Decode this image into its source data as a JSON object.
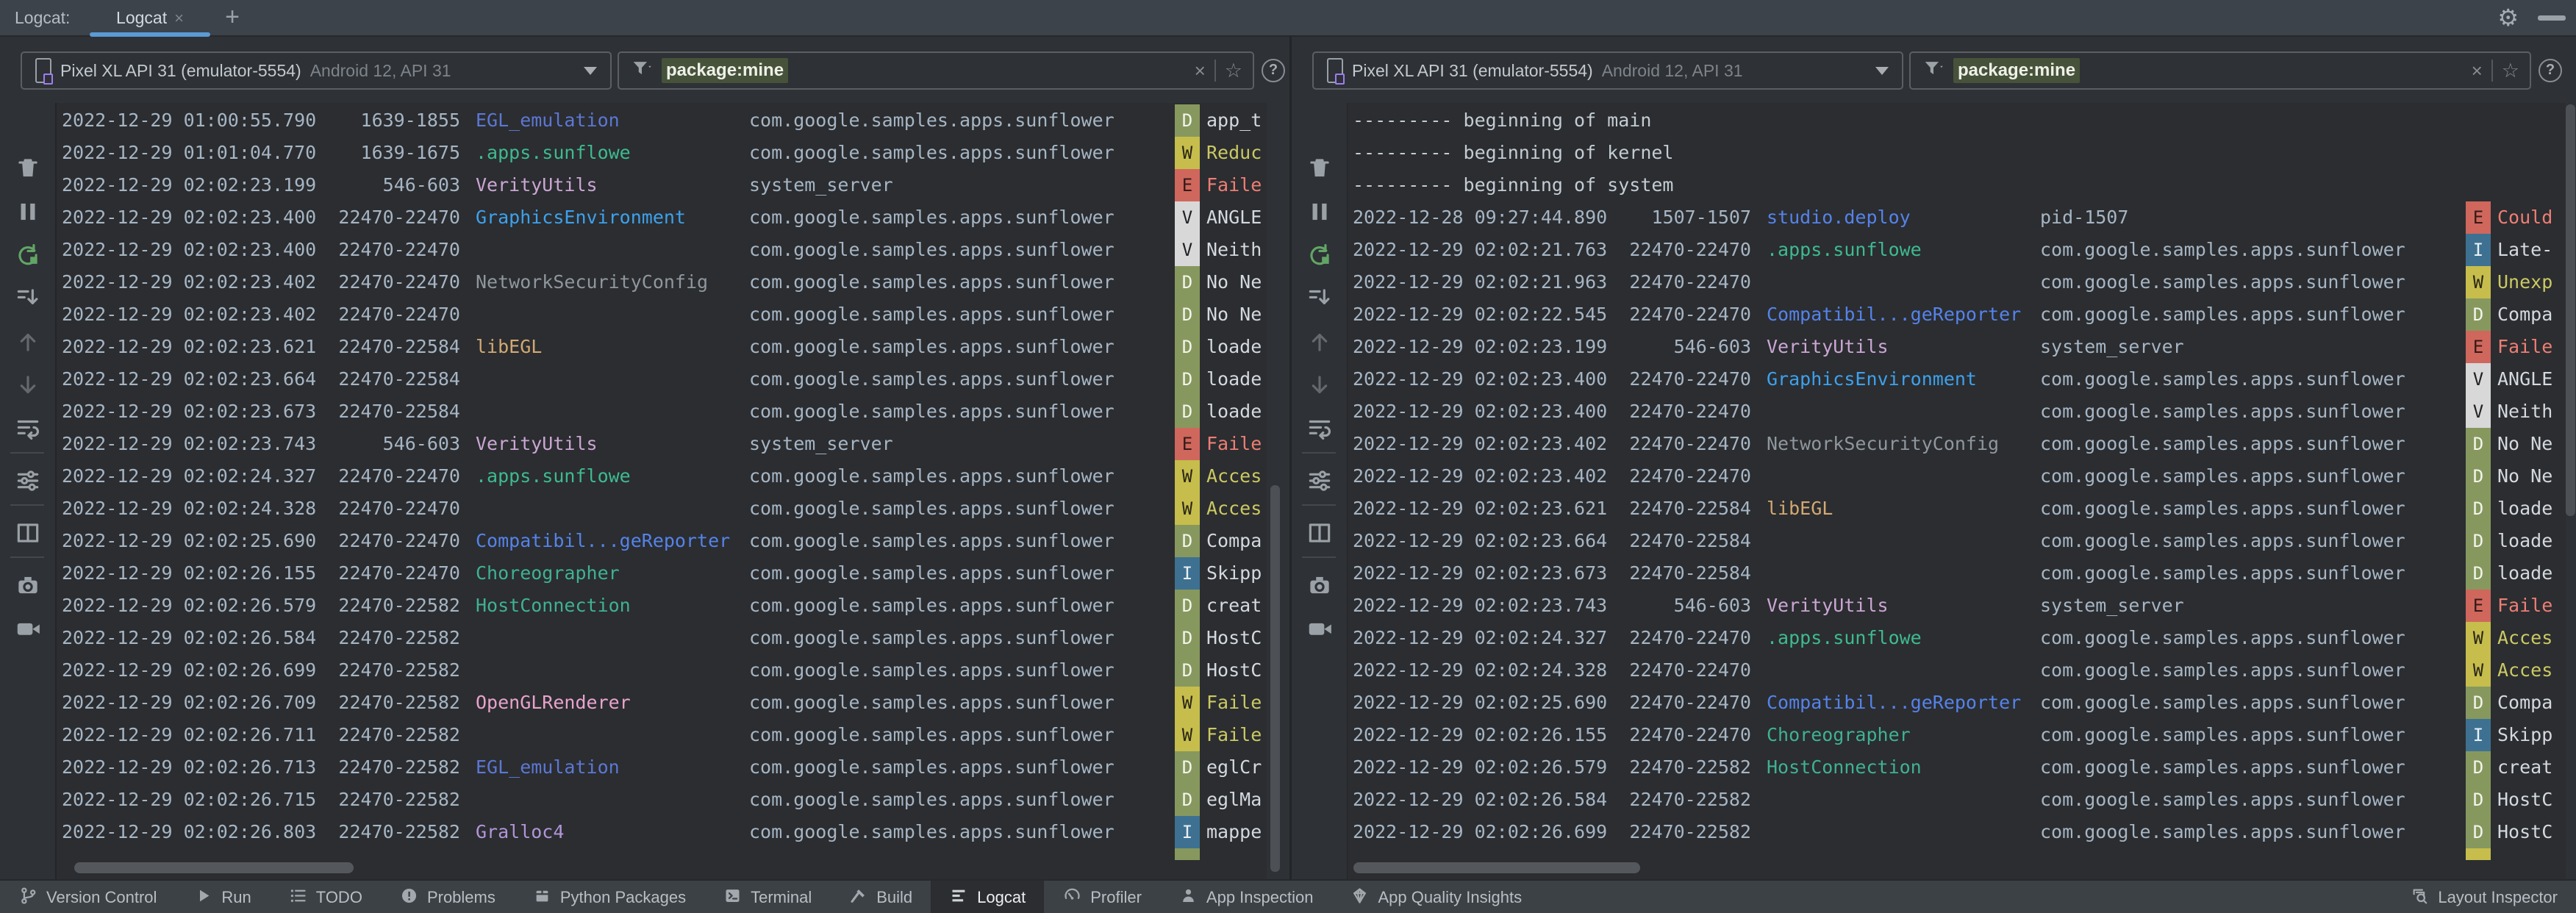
{
  "tabbar": {
    "window_label": "Logcat:",
    "tab_label": "Logcat",
    "close_label": "×",
    "add_label": "+"
  },
  "packages": {
    "app": "com.google.samples.apps.sunflower",
    "sys": "system_server",
    "pid1507": "pid-1507"
  },
  "tag_colors": {
    "blue": "#5c77d4",
    "teal": "#3eba90",
    "pink": "#cba6d4",
    "brightblue": "#3da1ed",
    "gray": "#8f979e",
    "tan": "#d3a972",
    "blue2": "#5583ea",
    "teal2": "#3fb194",
    "pink2": "#e8a3cd",
    "lavender": "#b295d8"
  },
  "level_colors": {
    "D": "#87985e",
    "W": "#c6bd4c",
    "E": "#cf675d",
    "V": "#d8d8d8",
    "I": "#3e7191"
  },
  "toolbar": {
    "icons": [
      "clear-logcat",
      "pause",
      "restart-logcat",
      "scroll-to-end",
      "previous-occurrence",
      "next-occurrence",
      "soft-wrap",
      "configure-logcat",
      "split-panels",
      "screenshot",
      "screen-record"
    ],
    "separators_after": [
      6,
      7,
      8
    ]
  },
  "panels": [
    {
      "device": {
        "name": "Pixel XL API 31 (emulator-5554)",
        "info": "Android 12, API 31"
      },
      "filter": {
        "value": "package:mine"
      },
      "partial_badge": "D",
      "rows": [
        {
          "t": "2022-12-29 01:00:55.790",
          "p": "1639-1855",
          "g": "EGL_emulation",
          "c": "blue",
          "k": "app",
          "l": "D",
          "m": "app_t"
        },
        {
          "t": "2022-12-29 01:01:04.770",
          "p": "1639-1675",
          "g": ".apps.sunflowe",
          "c": "teal",
          "k": "app",
          "l": "W",
          "m": "Reduc"
        },
        {
          "t": "2022-12-29 02:02:23.199",
          "p": "546-603 ",
          "g": "VerityUtils",
          "c": "pink",
          "k": "sys",
          "l": "E",
          "m": "Faile"
        },
        {
          "t": "2022-12-29 02:02:23.400",
          "p": "22470-22470",
          "g": "GraphicsEnvironment",
          "c": "brightblue",
          "k": "app",
          "l": "V",
          "m": "ANGLE"
        },
        {
          "t": "2022-12-29 02:02:23.400",
          "p": "22470-22470",
          "g": "",
          "c": "",
          "k": "app",
          "l": "V",
          "m": "Neith"
        },
        {
          "t": "2022-12-29 02:02:23.402",
          "p": "22470-22470",
          "g": "NetworkSecurityConfig",
          "c": "gray",
          "k": "app",
          "l": "D",
          "m": "No Ne"
        },
        {
          "t": "2022-12-29 02:02:23.402",
          "p": "22470-22470",
          "g": "",
          "c": "",
          "k": "app",
          "l": "D",
          "m": "No Ne"
        },
        {
          "t": "2022-12-29 02:02:23.621",
          "p": "22470-22584",
          "g": "libEGL",
          "c": "tan",
          "k": "app",
          "l": "D",
          "m": "loade"
        },
        {
          "t": "2022-12-29 02:02:23.664",
          "p": "22470-22584",
          "g": "",
          "c": "",
          "k": "app",
          "l": "D",
          "m": "loade"
        },
        {
          "t": "2022-12-29 02:02:23.673",
          "p": "22470-22584",
          "g": "",
          "c": "",
          "k": "app",
          "l": "D",
          "m": "loade"
        },
        {
          "t": "2022-12-29 02:02:23.743",
          "p": "546-603 ",
          "g": "VerityUtils",
          "c": "pink",
          "k": "sys",
          "l": "E",
          "m": "Faile"
        },
        {
          "t": "2022-12-29 02:02:24.327",
          "p": "22470-22470",
          "g": ".apps.sunflowe",
          "c": "teal",
          "k": "app",
          "l": "W",
          "m": "Acces"
        },
        {
          "t": "2022-12-29 02:02:24.328",
          "p": "22470-22470",
          "g": "",
          "c": "",
          "k": "app",
          "l": "W",
          "m": "Acces"
        },
        {
          "t": "2022-12-29 02:02:25.690",
          "p": "22470-22470",
          "g": "Compatibil...geReporter",
          "c": "blue2",
          "k": "app",
          "l": "D",
          "m": "Compa"
        },
        {
          "t": "2022-12-29 02:02:26.155",
          "p": "22470-22470",
          "g": "Choreographer",
          "c": "teal2",
          "k": "app",
          "l": "I",
          "m": "Skipp"
        },
        {
          "t": "2022-12-29 02:02:26.579",
          "p": "22470-22582",
          "g": "HostConnection",
          "c": "teal2",
          "k": "app",
          "l": "D",
          "m": "creat"
        },
        {
          "t": "2022-12-29 02:02:26.584",
          "p": "22470-22582",
          "g": "",
          "c": "",
          "k": "app",
          "l": "D",
          "m": "HostC"
        },
        {
          "t": "2022-12-29 02:02:26.699",
          "p": "22470-22582",
          "g": "",
          "c": "",
          "k": "app",
          "l": "D",
          "m": "HostC"
        },
        {
          "t": "2022-12-29 02:02:26.709",
          "p": "22470-22582",
          "g": "OpenGLRenderer",
          "c": "pink2",
          "k": "app",
          "l": "W",
          "m": "Faile"
        },
        {
          "t": "2022-12-29 02:02:26.711",
          "p": "22470-22582",
          "g": "",
          "c": "",
          "k": "app",
          "l": "W",
          "m": "Faile"
        },
        {
          "t": "2022-12-29 02:02:26.713",
          "p": "22470-22582",
          "g": "EGL_emulation",
          "c": "blue",
          "k": "app",
          "l": "D",
          "m": "eglCr"
        },
        {
          "t": "2022-12-29 02:02:26.715",
          "p": "22470-22582",
          "g": "",
          "c": "",
          "k": "app",
          "l": "D",
          "m": "eglMa"
        },
        {
          "t": "2022-12-29 02:02:26.803",
          "p": "22470-22582",
          "g": "Gralloc4",
          "c": "lavender",
          "k": "app",
          "l": "I",
          "m": "mappe"
        }
      ]
    },
    {
      "device": {
        "name": "Pixel XL API 31 (emulator-5554)",
        "info": "Android 12, API 31"
      },
      "filter": {
        "value": "package:mine"
      },
      "partial_badge": "W",
      "rows": [
        {
          "raw": "--------- beginning of main"
        },
        {
          "raw": "--------- beginning of kernel"
        },
        {
          "raw": "--------- beginning of system"
        },
        {
          "t": "2022-12-28 09:27:44.890",
          "p": "1507-1507",
          "g": "studio.deploy",
          "c": "blue2",
          "k": "pid1507",
          "l": "E",
          "m": "Could"
        },
        {
          "t": "2022-12-29 02:02:21.763",
          "p": "22470-22470",
          "g": ".apps.sunflowe",
          "c": "teal",
          "k": "app",
          "l": "I",
          "m": "Late-"
        },
        {
          "t": "2022-12-29 02:02:21.963",
          "p": "22470-22470",
          "g": "",
          "c": "",
          "k": "app",
          "l": "W",
          "m": "Unexp"
        },
        {
          "t": "2022-12-29 02:02:22.545",
          "p": "22470-22470",
          "g": "Compatibil...geReporter",
          "c": "blue2",
          "k": "app",
          "l": "D",
          "m": "Compa"
        },
        {
          "t": "2022-12-29 02:02:23.199",
          "p": "546-603 ",
          "g": "VerityUtils",
          "c": "pink",
          "k": "sys",
          "l": "E",
          "m": "Faile"
        },
        {
          "t": "2022-12-29 02:02:23.400",
          "p": "22470-22470",
          "g": "GraphicsEnvironment",
          "c": "brightblue",
          "k": "app",
          "l": "V",
          "m": "ANGLE"
        },
        {
          "t": "2022-12-29 02:02:23.400",
          "p": "22470-22470",
          "g": "",
          "c": "",
          "k": "app",
          "l": "V",
          "m": "Neith"
        },
        {
          "t": "2022-12-29 02:02:23.402",
          "p": "22470-22470",
          "g": "NetworkSecurityConfig",
          "c": "gray",
          "k": "app",
          "l": "D",
          "m": "No Ne"
        },
        {
          "t": "2022-12-29 02:02:23.402",
          "p": "22470-22470",
          "g": "",
          "c": "",
          "k": "app",
          "l": "D",
          "m": "No Ne"
        },
        {
          "t": "2022-12-29 02:02:23.621",
          "p": "22470-22584",
          "g": "libEGL",
          "c": "tan",
          "k": "app",
          "l": "D",
          "m": "loade"
        },
        {
          "t": "2022-12-29 02:02:23.664",
          "p": "22470-22584",
          "g": "",
          "c": "",
          "k": "app",
          "l": "D",
          "m": "loade"
        },
        {
          "t": "2022-12-29 02:02:23.673",
          "p": "22470-22584",
          "g": "",
          "c": "",
          "k": "app",
          "l": "D",
          "m": "loade"
        },
        {
          "t": "2022-12-29 02:02:23.743",
          "p": "546-603 ",
          "g": "VerityUtils",
          "c": "pink",
          "k": "sys",
          "l": "E",
          "m": "Faile"
        },
        {
          "t": "2022-12-29 02:02:24.327",
          "p": "22470-22470",
          "g": ".apps.sunflowe",
          "c": "teal",
          "k": "app",
          "l": "W",
          "m": "Acces"
        },
        {
          "t": "2022-12-29 02:02:24.328",
          "p": "22470-22470",
          "g": "",
          "c": "",
          "k": "app",
          "l": "W",
          "m": "Acces"
        },
        {
          "t": "2022-12-29 02:02:25.690",
          "p": "22470-22470",
          "g": "Compatibil...geReporter",
          "c": "blue2",
          "k": "app",
          "l": "D",
          "m": "Compa"
        },
        {
          "t": "2022-12-29 02:02:26.155",
          "p": "22470-22470",
          "g": "Choreographer",
          "c": "teal2",
          "k": "app",
          "l": "I",
          "m": "Skipp"
        },
        {
          "t": "2022-12-29 02:02:26.579",
          "p": "22470-22582",
          "g": "HostConnection",
          "c": "teal2",
          "k": "app",
          "l": "D",
          "m": "creat"
        },
        {
          "t": "2022-12-29 02:02:26.584",
          "p": "22470-22582",
          "g": "",
          "c": "",
          "k": "app",
          "l": "D",
          "m": "HostC"
        },
        {
          "t": "2022-12-29 02:02:26.699",
          "p": "22470-22582",
          "g": "",
          "c": "",
          "k": "app",
          "l": "D",
          "m": "HostC"
        }
      ]
    }
  ],
  "statusbar": {
    "left": [
      {
        "icon": "git-branch",
        "label": "Version Control"
      },
      {
        "icon": "play",
        "label": "Run"
      },
      {
        "icon": "todo-list",
        "label": "TODO"
      },
      {
        "icon": "error-circle",
        "label": "Problems"
      },
      {
        "icon": "package",
        "label": "Python Packages"
      },
      {
        "icon": "terminal",
        "label": "Terminal"
      },
      {
        "icon": "hammer",
        "label": "Build"
      },
      {
        "icon": "logcat-lines",
        "label": "Logcat",
        "active": true
      },
      {
        "icon": "gauge",
        "label": "Profiler"
      },
      {
        "icon": "inspection",
        "label": "App Inspection"
      },
      {
        "icon": "gem",
        "label": "App Quality Insights"
      }
    ],
    "right": [
      {
        "icon": "layout-inspector",
        "label": "Layout Inspector"
      }
    ]
  }
}
